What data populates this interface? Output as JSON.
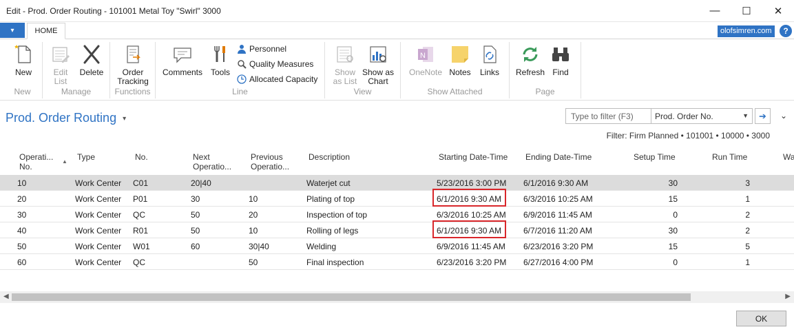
{
  "window": {
    "title": "Edit - Prod. Order Routing - 101001 Metal Toy \"Swirl\" 3000",
    "minimize": "—",
    "maximize": "☐",
    "close": "✕"
  },
  "tabs": {
    "app_menu": "▾",
    "home": "HOME"
  },
  "user": {
    "name": "olofsimren.com",
    "help": "?"
  },
  "ribbon": {
    "new": {
      "new_label": "New",
      "group_label": "New"
    },
    "manage": {
      "edit_list_l1": "Edit",
      "edit_list_l2": "List",
      "delete": "Delete",
      "group_label": "Manage"
    },
    "functions": {
      "order_tracking_l1": "Order",
      "order_tracking_l2": "Tracking",
      "group_label": "Functions"
    },
    "line": {
      "comments": "Comments",
      "tools": "Tools",
      "personnel": "Personnel",
      "quality_measures": "Quality Measures",
      "allocated_capacity": "Allocated Capacity",
      "group_label": "Line"
    },
    "view": {
      "show_as_list_l1": "Show",
      "show_as_list_l2": "as List",
      "show_as_chart_l1": "Show as",
      "show_as_chart_l2": "Chart",
      "group_label": "View"
    },
    "show_attached": {
      "onenote": "OneNote",
      "notes": "Notes",
      "links": "Links",
      "group_label": "Show Attached"
    },
    "page": {
      "refresh": "Refresh",
      "find": "Find",
      "group_label": "Page"
    }
  },
  "page": {
    "title": "Prod. Order Routing",
    "title_dropdown": "▾",
    "filter_placeholder": "Type to filter (F3)",
    "filter_field": "Prod. Order No.",
    "filter_field_dropdown": "▼",
    "go_arrow": "➔",
    "collapse": "⌄",
    "filter_info": "Filter: Firm Planned • 101001 • 10000 • 3000"
  },
  "table": {
    "headers": {
      "operation_l1": "Operati...",
      "operation_l2": "No.",
      "sort_arrow": "▲",
      "type": "Type",
      "no": "No.",
      "next_l1": "Next",
      "next_l2": "Operatio...",
      "prev_l1": "Previous",
      "prev_l2": "Operatio...",
      "description": "Description",
      "starting": "Starting Date-Time",
      "ending": "Ending Date-Time",
      "setup": "Setup Time",
      "run": "Run Time",
      "wait": "Wa"
    },
    "rows": [
      {
        "op": "10",
        "type": "Work Center",
        "no": "C01",
        "next": "20|40",
        "prev": "",
        "desc": "Waterjet cut",
        "start": "5/23/2016 3:00 PM",
        "end": "6/1/2016 9:30 AM",
        "setup": "30",
        "run": "3"
      },
      {
        "op": "20",
        "type": "Work Center",
        "no": "P01",
        "next": "30",
        "prev": "10",
        "desc": "Plating of top",
        "start": "6/1/2016 9:30 AM",
        "end": "6/3/2016 10:25 AM",
        "setup": "15",
        "run": "1"
      },
      {
        "op": "30",
        "type": "Work Center",
        "no": "QC",
        "next": "50",
        "prev": "20",
        "desc": "Inspection of top",
        "start": "6/3/2016 10:25 AM",
        "end": "6/9/2016 11:45 AM",
        "setup": "0",
        "run": "2"
      },
      {
        "op": "40",
        "type": "Work Center",
        "no": "R01",
        "next": "50",
        "prev": "10",
        "desc": "Rolling of legs",
        "start": "6/1/2016 9:30 AM",
        "end": "6/7/2016 11:20 AM",
        "setup": "30",
        "run": "2"
      },
      {
        "op": "50",
        "type": "Work Center",
        "no": "W01",
        "next": "60",
        "prev": "30|40",
        "desc": "Welding",
        "start": "6/9/2016 11:45 AM",
        "end": "6/23/2016 3:20 PM",
        "setup": "15",
        "run": "5"
      },
      {
        "op": "60",
        "type": "Work Center",
        "no": "QC",
        "next": "",
        "prev": "50",
        "desc": "Final inspection",
        "start": "6/23/2016 3:20 PM",
        "end": "6/27/2016 4:00 PM",
        "setup": "0",
        "run": "1"
      }
    ]
  },
  "scroll": {
    "left": "◀",
    "right": "▶"
  },
  "footer": {
    "ok": "OK"
  },
  "colors": {
    "accent": "#2f73c4",
    "highlight_border": "#d9262a",
    "selected_row": "#dcdcdc"
  }
}
